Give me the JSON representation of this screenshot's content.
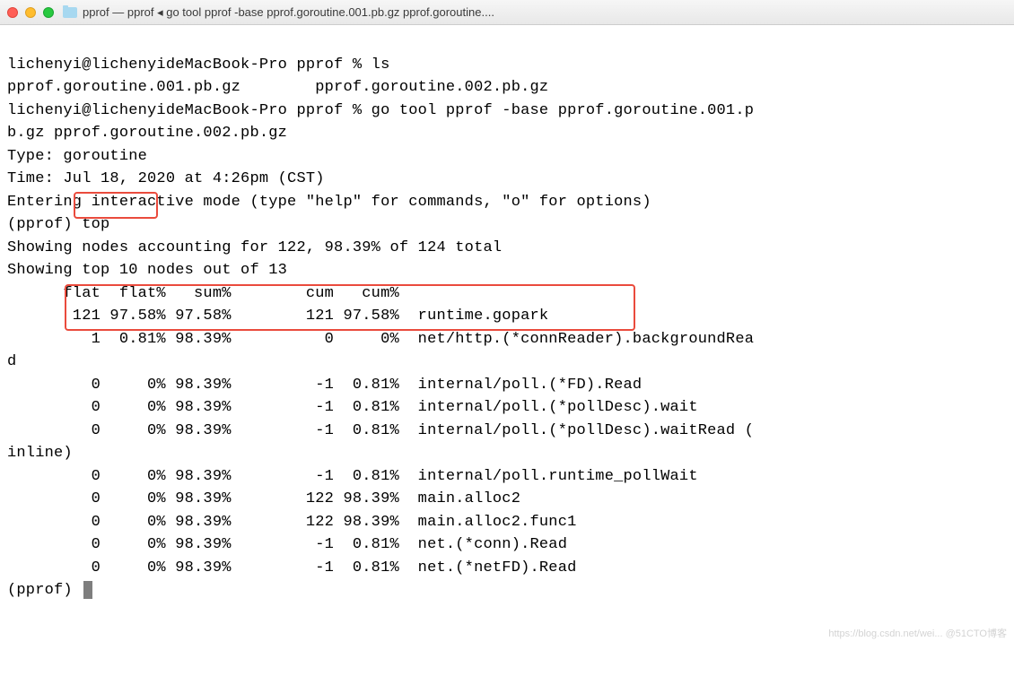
{
  "window": {
    "title": "pprof — pprof ◂ go tool pprof -base pprof.goroutine.001.pb.gz pprof.goroutine...."
  },
  "prompt1": {
    "line": "lichenyi@lichenyideMacBook-Pro pprof % ls"
  },
  "ls_output": "pprof.goroutine.001.pb.gz        pprof.goroutine.002.pb.gz",
  "prompt2_line1": "lichenyi@lichenyideMacBook-Pro pprof % go tool pprof -base pprof.goroutine.001.p",
  "prompt2_line2": "b.gz pprof.goroutine.002.pb.gz",
  "pprof_header": {
    "type": "Type: goroutine",
    "time": "Time: Jul 18, 2020 at 4:26pm (CST)",
    "mode": "Entering interactive mode (type \"help\" for commands, \"o\" for options)"
  },
  "pprof_prompt_top": "(pprof) top",
  "summary1": "Showing nodes accounting for 122, 98.39% of 124 total",
  "summary2": "Showing top 10 nodes out of 13",
  "table_header": "      flat  flat%   sum%        cum   cum%",
  "rows": {
    "r0": "       121 97.58% 97.58%        121 97.58%  runtime.gopark",
    "r1a": "         1  0.81% 98.39%          0     0%  net/http.(*connReader).backgroundRea",
    "r1b": "d",
    "r2": "         0     0% 98.39%         -1  0.81%  internal/poll.(*FD).Read",
    "r3": "         0     0% 98.39%         -1  0.81%  internal/poll.(*pollDesc).wait",
    "r4a": "         0     0% 98.39%         -1  0.81%  internal/poll.(*pollDesc).waitRead (",
    "r4b": "inline)",
    "r5": "         0     0% 98.39%         -1  0.81%  internal/poll.runtime_pollWait",
    "r6": "         0     0% 98.39%        122 98.39%  main.alloc2",
    "r7": "         0     0% 98.39%        122 98.39%  main.alloc2.func1",
    "r8": "         0     0% 98.39%         -1  0.81%  net.(*conn).Read",
    "r9": "         0     0% 98.39%         -1  0.81%  net.(*netFD).Read"
  },
  "pprof_prompt_end": "(pprof) ",
  "watermark": {
    "line1": "https://blog.csdn.net/wei... @51CTO博客"
  }
}
